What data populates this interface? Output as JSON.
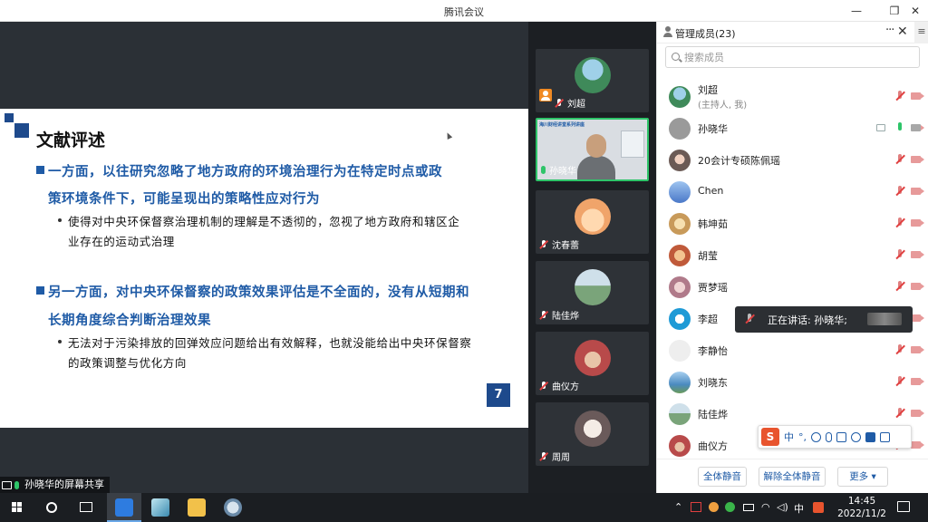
{
  "window": {
    "title": "腾讯会议",
    "controls": [
      "minimize",
      "restore",
      "close"
    ]
  },
  "slide": {
    "heading": "文献评述",
    "bullet1": {
      "line1": "一方面，以往研究忽略了地方政府的环境治理行为在特定时点或政",
      "line2": "策环境条件下，可能呈现出的策略性应对行为",
      "sub_line1": "使得对中央环保督察治理机制的理解是不透彻的，忽视了地方政府和辖区企",
      "sub_line2": "业存在的运动式治理"
    },
    "bullet2": {
      "line1": "另一方面，对中央环保督察的政策效果评估是不全面的，没有从短期和",
      "line2": "长期角度综合判断治理效果",
      "sub_line1": "无法对于污染排放的回弹效应问题给出有效解释，也就没能给出中央环保督察",
      "sub_line2": "的政策调整与优化方向"
    },
    "page_number": "7",
    "accent_color": "#1f5ba6"
  },
  "share_badge": {
    "label": "孙晓华的屏幕共享",
    "icon": "screen-share-icon"
  },
  "video_tiles": [
    {
      "name": "刘超",
      "host": true,
      "muted": true,
      "avatar_color": "#3f8a5a"
    },
    {
      "name": "孙晓华",
      "host": false,
      "muted": false,
      "camera_on": true,
      "banner": "海川财经讲堂系列讲座"
    },
    {
      "name": "沈春蕾",
      "host": false,
      "muted": true,
      "avatar_color": "#f0a46a"
    },
    {
      "name": "陆佳烨",
      "host": false,
      "muted": true,
      "avatar_color": "#7aa47a"
    },
    {
      "name": "曲仪方",
      "host": false,
      "muted": true,
      "avatar_color": "#b84a4a"
    },
    {
      "name": "周周",
      "host": false,
      "muted": true,
      "avatar_color": "#d8cfd0"
    }
  ],
  "members": {
    "title": "管理成员(23)",
    "search_placeholder": "搜索成员",
    "list": [
      {
        "name": "刘超",
        "sub": "(主持人, 我)",
        "mic": "muted",
        "avatar_color": "#3f8a5a"
      },
      {
        "name": "孙晓华",
        "sub": "",
        "mic": "on",
        "sharing": true,
        "avatar_color": "#9a9a9a"
      },
      {
        "name": "20会计专硕陈佩瑶",
        "sub": "",
        "mic": "muted",
        "avatar_color": "#6b5a55"
      },
      {
        "name": "Chen",
        "sub": "",
        "mic": "muted",
        "avatar_color": "#4a78c8"
      },
      {
        "name": "韩坤茹",
        "sub": "",
        "mic": "muted",
        "avatar_color": "#c89a5a"
      },
      {
        "name": "胡莹",
        "sub": "",
        "mic": "muted",
        "avatar_color": "#c05a3a"
      },
      {
        "name": "贾梦瑶",
        "sub": "",
        "mic": "muted",
        "avatar_color": "#b07a8a"
      },
      {
        "name": "李超",
        "sub": "",
        "mic": "muted",
        "avatar_color": "#1e9ad6"
      },
      {
        "name": "李静怡",
        "sub": "",
        "mic": "muted",
        "avatar_color": "#eeeeee"
      },
      {
        "name": "刘晓东",
        "sub": "",
        "mic": "muted",
        "avatar_color": "#4a8ac0"
      },
      {
        "name": "陆佳烨",
        "sub": "",
        "mic": "muted",
        "avatar_color": "#7aa47a"
      },
      {
        "name": "曲仪方",
        "sub": "",
        "mic": "muted",
        "avatar_color": "#b84a4a"
      }
    ],
    "speaking_tooltip": "正在讲话: 孙晓华;",
    "buttons": {
      "mute_all": "全体静音",
      "unmute_all": "解除全体静音",
      "more": "更多 ▾"
    }
  },
  "ime_toolbar": {
    "logo": "S",
    "mode": "中",
    "punct": "°,"
  },
  "taskbar": {
    "tray_lang": "中",
    "time": "14:45",
    "date": "2022/11/2"
  }
}
